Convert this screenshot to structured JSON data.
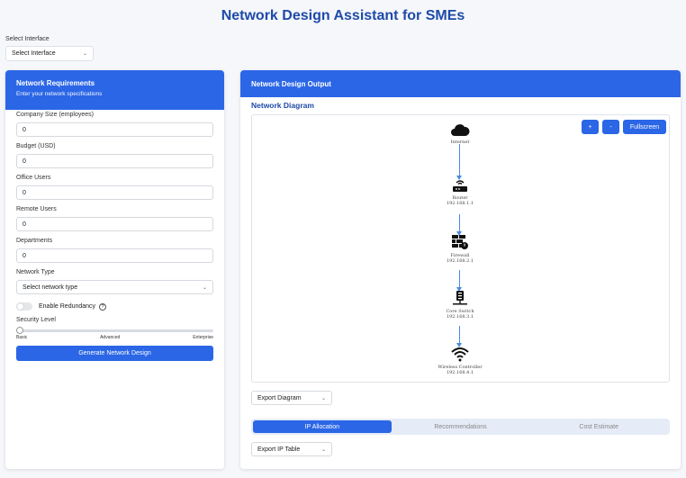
{
  "app_title": "Network Design Assistant for SMEs",
  "interface": {
    "label": "Select Interface",
    "value": "Select Interface"
  },
  "left_panel": {
    "title": "Network Requirements",
    "subtitle": "Enter your network specifications",
    "fields": [
      {
        "label": "Company Size (employees)",
        "value": "0"
      },
      {
        "label": "Budget (USD)",
        "value": "0"
      },
      {
        "label": "Office Users",
        "value": "0"
      },
      {
        "label": "Remote Users",
        "value": "0"
      },
      {
        "label": "Departments",
        "value": "0"
      }
    ],
    "network_type": {
      "label": "Network Type",
      "value": "Select network type"
    },
    "redundancy": {
      "label": "Enable Redundancy",
      "help": "?",
      "enabled": false
    },
    "security": {
      "label": "Security Level",
      "level": 0,
      "ticks": [
        "Basic",
        "Advanced",
        "Enterprise"
      ]
    },
    "generate_label": "Generate Network Design"
  },
  "right_panel": {
    "title": "Network Design Output",
    "diagram_title": "Network Diagram",
    "controls": {
      "zoom_in": "+",
      "zoom_out": "-",
      "fullscreen": "Fullscreen"
    },
    "nodes": [
      {
        "name": "Internet",
        "ip": "",
        "icon": "cloud-icon"
      },
      {
        "name": "Router",
        "ip": "192.168.1.1",
        "icon": "router-icon"
      },
      {
        "name": "Firewall",
        "ip": "192.168.2.1",
        "icon": "firewall-icon"
      },
      {
        "name": "Core Switch",
        "ip": "192.168.3.1",
        "icon": "switch-icon"
      },
      {
        "name": "Wireless Controller",
        "ip": "192.168.4.1",
        "icon": "wifi-icon"
      }
    ],
    "export_diagram": "Export Diagram",
    "tabs": [
      "IP Allocation",
      "Recommendations",
      "Cost Estimate"
    ],
    "active_tab": 0,
    "export_ip_table": "Export IP Table"
  },
  "colors": {
    "accent": "#2b66e6",
    "title": "#1e4aa8",
    "edge": "#4a8be0"
  }
}
